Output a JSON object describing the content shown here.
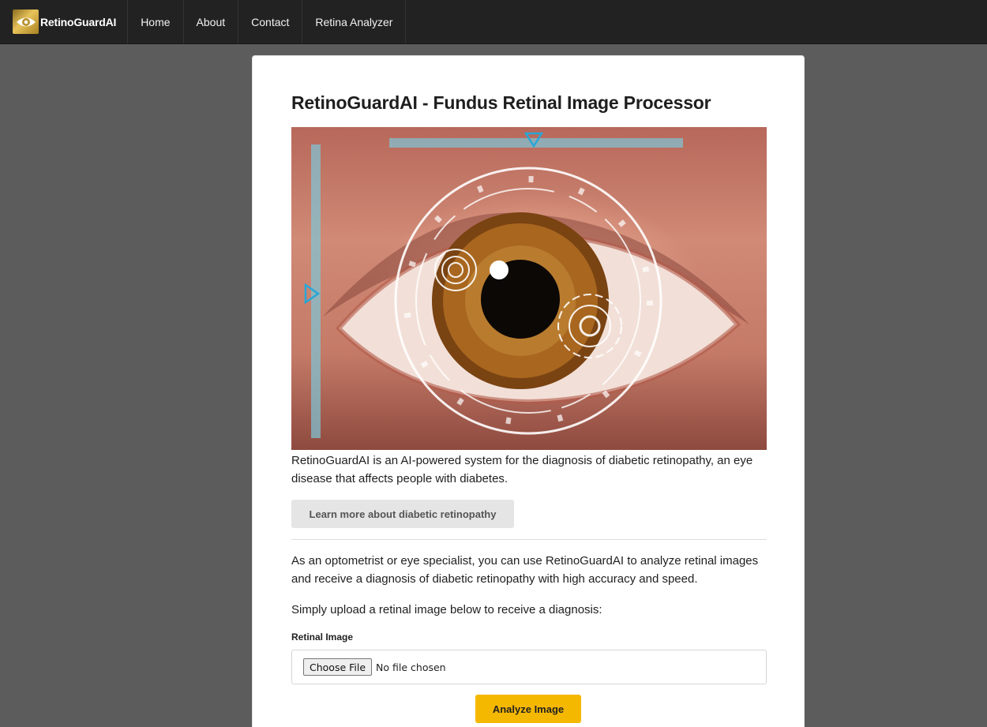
{
  "navbar": {
    "brand": "RetinoGuardAI",
    "links": [
      "Home",
      "About",
      "Contact",
      "Retina Analyzer"
    ]
  },
  "main": {
    "title": "RetinoGuardAI - Fundus Retinal Image Processor",
    "description": "RetinoGuardAI is an AI-powered system for the diagnosis of diabetic retinopathy, an eye disease that affects people with diabetes.",
    "learn_more_label": "Learn more about diabetic retinopathy",
    "paragraph_1": "As an optometrist or eye specialist, you can use RetinoGuardAI to analyze retinal images and receive a diagnosis of diabetic retinopathy with high accuracy and speed.",
    "paragraph_2": "Simply upload a retinal image below to receive a diagnosis:",
    "upload": {
      "label": "Retinal Image",
      "choose_label": "Choose File",
      "status": "No file chosen"
    },
    "analyze_label": "Analyze Image"
  },
  "colors": {
    "navbar_bg": "#222222",
    "page_bg": "#5c5c5c",
    "accent_button": "#f5b800",
    "secondary_button": "#e5e5e5"
  }
}
